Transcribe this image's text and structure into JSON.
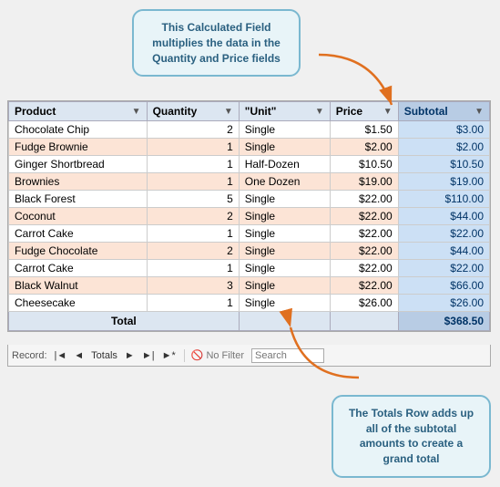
{
  "callout_top": {
    "text": "This Calculated Field multiplies the data in the Quantity and Price fields"
  },
  "callout_bottom": {
    "text": "The Totals Row adds up all of the subtotal amounts to create a grand total"
  },
  "table": {
    "columns": [
      {
        "key": "product",
        "label": "Product",
        "filter": true
      },
      {
        "key": "quantity",
        "label": "Quantity",
        "filter": true
      },
      {
        "key": "unit",
        "label": "\"Unit\"",
        "filter": true
      },
      {
        "key": "price",
        "label": "Price",
        "filter": true
      },
      {
        "key": "subtotal",
        "label": "Subtotal",
        "filter": true
      }
    ],
    "rows": [
      {
        "product": "Chocolate Chip",
        "quantity": "2",
        "unit": "Single",
        "price": "$1.50",
        "subtotal": "$3.00"
      },
      {
        "product": "Fudge Brownie",
        "quantity": "1",
        "unit": "Single",
        "price": "$2.00",
        "subtotal": "$2.00"
      },
      {
        "product": "Ginger Shortbread",
        "quantity": "1",
        "unit": "Half-Dozen",
        "price": "$10.50",
        "subtotal": "$10.50"
      },
      {
        "product": "Brownies",
        "quantity": "1",
        "unit": "One Dozen",
        "price": "$19.00",
        "subtotal": "$19.00"
      },
      {
        "product": "Black Forest",
        "quantity": "5",
        "unit": "Single",
        "price": "$22.00",
        "subtotal": "$110.00"
      },
      {
        "product": "Coconut",
        "quantity": "2",
        "unit": "Single",
        "price": "$22.00",
        "subtotal": "$44.00"
      },
      {
        "product": "Carrot Cake",
        "quantity": "1",
        "unit": "Single",
        "price": "$22.00",
        "subtotal": "$22.00"
      },
      {
        "product": "Fudge Chocolate",
        "quantity": "2",
        "unit": "Single",
        "price": "$22.00",
        "subtotal": "$44.00"
      },
      {
        "product": "Carrot Cake",
        "quantity": "1",
        "unit": "Single",
        "price": "$22.00",
        "subtotal": "$22.00"
      },
      {
        "product": "Black Walnut",
        "quantity": "3",
        "unit": "Single",
        "price": "$22.00",
        "subtotal": "$66.00"
      },
      {
        "product": "Cheesecake",
        "quantity": "1",
        "unit": "Single",
        "price": "$26.00",
        "subtotal": "$26.00"
      }
    ],
    "total_row": {
      "label": "Total",
      "subtotal": "$368.50"
    }
  },
  "nav": {
    "record_label": "Record:",
    "totals_label": "Totals",
    "no_filter_label": "No Filter",
    "search_label": "Search",
    "search_placeholder": ""
  }
}
